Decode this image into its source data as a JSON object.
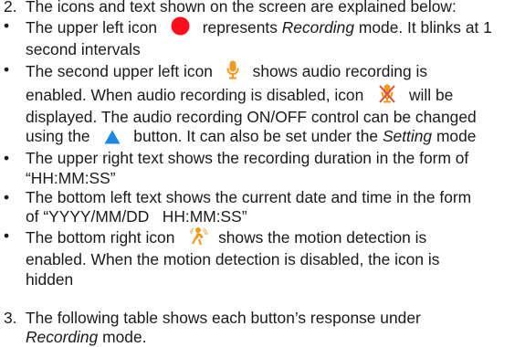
{
  "colors": {
    "text": "#1a1a1a",
    "record_icon": "#ff0d1b",
    "mic_icon": "#f39a1e",
    "up_arrow": "#1a87e0"
  },
  "icons": {
    "record": "record-dot-icon",
    "mic_on": "microphone-icon",
    "mic_off": "microphone-muted-icon",
    "up_button": "up-triangle-button-icon",
    "motion": "motion-detection-icon"
  },
  "section2": {
    "number": "2.",
    "intro": "The icons and text shown on the screen are explained below:",
    "bullet_symbol": "•",
    "b1": {
      "l1_pre": "The upper left icon",
      "l1_mid": "represents",
      "l1_em": "Recording",
      "l1_post": "mode. It blinks at 1",
      "l2": "second intervals"
    },
    "b2": {
      "l1_pre": "The second upper left icon",
      "l1_post": "shows audio recording is",
      "l2_pre": "enabled. When audio recording is disabled, icon",
      "l2_post": "will be",
      "l3": "displayed. The audio recording ON/OFF control can be changed",
      "l4_pre": "using the",
      "l4_mid": "button. It can also be set under the",
      "l4_em": "Setting",
      "l4_post": "mode"
    },
    "b3": {
      "l1": "The upper right text shows the recording duration in the form of",
      "l2": "“HH:MM:SS”"
    },
    "b4": {
      "l1": "The bottom left text shows the current date and time in the form",
      "l2": "of “YYYY/MM/DD   HH:MM:SS”"
    },
    "b5": {
      "l1_pre": "The bottom right icon",
      "l1_post": "shows the motion detection is",
      "l2": "enabled. When the motion detection is disabled, the icon is",
      "l3": "hidden"
    }
  },
  "section3": {
    "number": "3.",
    "l1": "The following table shows each button’s response under",
    "l2_em": "Recording",
    "l2_post": "mode."
  }
}
